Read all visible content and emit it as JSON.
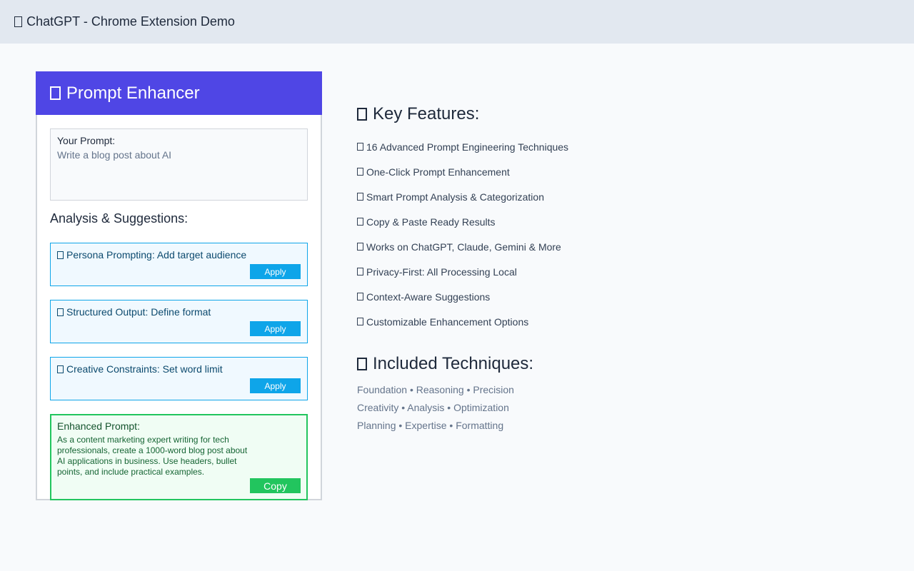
{
  "header": {
    "title": "ChatGPT - Chrome Extension Demo",
    "icon": "box-glyph-icon"
  },
  "panel": {
    "title": "Prompt Enhancer",
    "prompt_label": "Your Prompt:",
    "prompt_value": "Write a blog post about AI",
    "analysis_title": "Analysis & Suggestions:",
    "suggestions": [
      {
        "text": "Persona Prompting: Add target audience",
        "button": "Apply"
      },
      {
        "text": "Structured Output: Define format",
        "button": "Apply"
      },
      {
        "text": "Creative Constraints: Set word limit",
        "button": "Apply"
      }
    ],
    "enhanced_label": "Enhanced Prompt:",
    "enhanced_text": "As a content marketing expert writing for tech professionals, create a 1000-word blog post about AI applications in business. Use headers, bullet points, and include practical examples.",
    "copy_button": "Copy"
  },
  "features": {
    "title": "Key Features:",
    "items": [
      "16 Advanced Prompt Engineering Techniques",
      "One-Click Prompt Enhancement",
      "Smart Prompt Analysis & Categorization",
      "Copy & Paste Ready Results",
      "Works on ChatGPT, Claude, Gemini & More",
      "Privacy-First: All Processing Local",
      "Context-Aware Suggestions",
      "Customizable Enhancement Options"
    ]
  },
  "techniques": {
    "title": "Included Techniques:",
    "rows": [
      "Foundation • Reasoning • Precision",
      "Creativity • Analysis • Optimization",
      "Planning • Expertise • Formatting"
    ]
  },
  "colors": {
    "accent": "#4f46e5",
    "suggestion": "#0ea5e9",
    "success": "#22c55e"
  }
}
